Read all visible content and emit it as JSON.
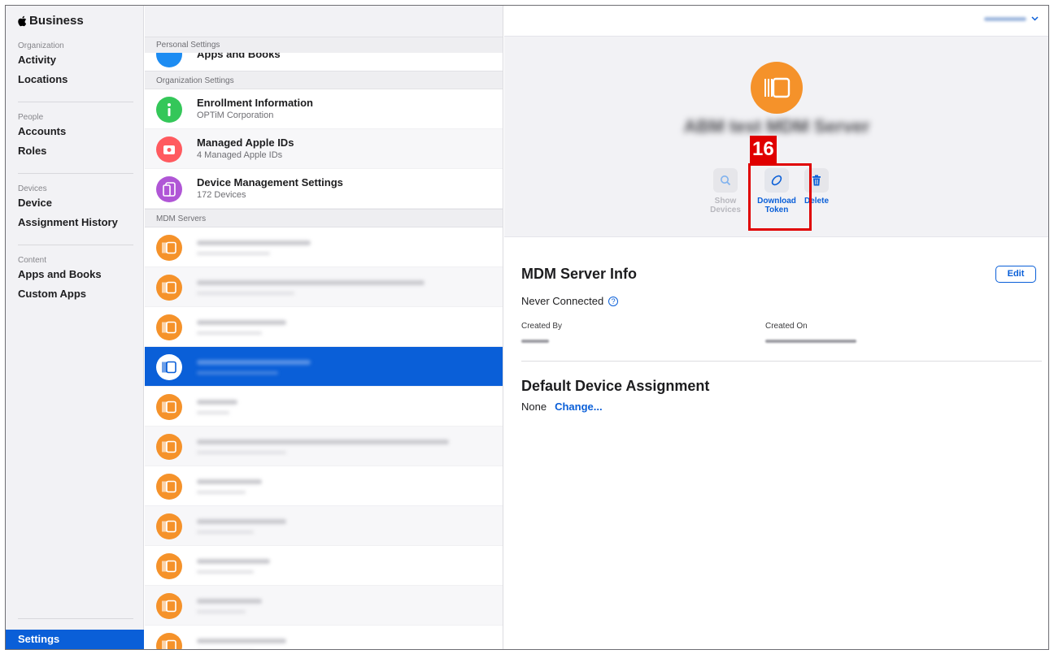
{
  "brand": {
    "name": "Business"
  },
  "nav": {
    "sections": [
      {
        "header": "Organization",
        "items": [
          "Activity",
          "Locations"
        ]
      },
      {
        "header": "People",
        "items": [
          "Accounts",
          "Roles"
        ]
      },
      {
        "header": "Devices",
        "items": [
          "Device",
          "Assignment History"
        ]
      },
      {
        "header": "Content",
        "items": [
          "Apps and Books",
          "Custom Apps"
        ]
      }
    ],
    "settings": "Settings"
  },
  "list": {
    "personal_header": "Personal Settings",
    "apps_books_partial": "Apps and Books",
    "org_header": "Organization Settings",
    "org_items": [
      {
        "title": "Enrollment Information",
        "subtitle": "OPTiM Corporation",
        "icon": "info-icon",
        "color": "#34c759"
      },
      {
        "title": "Managed Apple IDs",
        "subtitle": "4 Managed Apple IDs",
        "icon": "apple-id-icon",
        "color": "#ff5a5f"
      },
      {
        "title": "Device Management Settings",
        "subtitle": "172 Devices",
        "icon": "device-icon",
        "color": "#b056d6"
      }
    ],
    "mdm_header": "MDM Servers",
    "server_icon_color": "#f5922a"
  },
  "detail": {
    "server_name": "ABM test MDM Server",
    "actions": {
      "show_devices": "Show Devices",
      "download_token": "Download Token",
      "delete": "Delete"
    },
    "callout_number": "16",
    "info_title": "MDM Server Info",
    "edit": "Edit",
    "status": "Never Connected",
    "created_by_label": "Created By",
    "created_on_label": "Created On",
    "dda_title": "Default Device Assignment",
    "dda_value": "None",
    "dda_change": "Change..."
  },
  "colors": {
    "accent": "#0a5fd8",
    "callout": "#e00000"
  }
}
